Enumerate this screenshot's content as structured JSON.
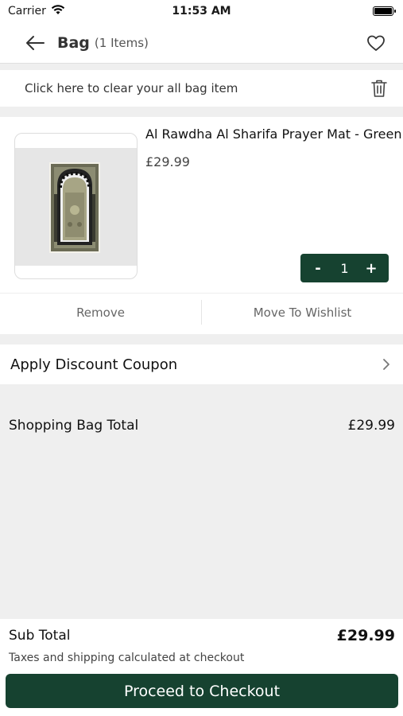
{
  "status_bar": {
    "carrier": "Carrier",
    "time": "11:53 AM"
  },
  "header": {
    "title": "Bag",
    "item_count": "(1 Items)"
  },
  "clear_bag": {
    "label": "Click here to clear your all bag item"
  },
  "product": {
    "name": "Al Rawdha Al Sharifa Prayer Mat - Green",
    "price": "£29.99",
    "quantity": "1",
    "decrement_label": "-",
    "increment_label": "+",
    "remove_label": "Remove",
    "wishlist_label": "Move To Wishlist"
  },
  "coupon": {
    "label": "Apply Discount Coupon"
  },
  "bag_total": {
    "label": "Shopping Bag Total",
    "value": "£29.99"
  },
  "footer": {
    "subtotal_label": "Sub Total",
    "subtotal_value": "£29.99",
    "tax_note": "Taxes and shipping calculated at checkout",
    "checkout_label": "Proceed to Checkout"
  },
  "colors": {
    "brand_green": "#164230",
    "background": "#efefef"
  }
}
